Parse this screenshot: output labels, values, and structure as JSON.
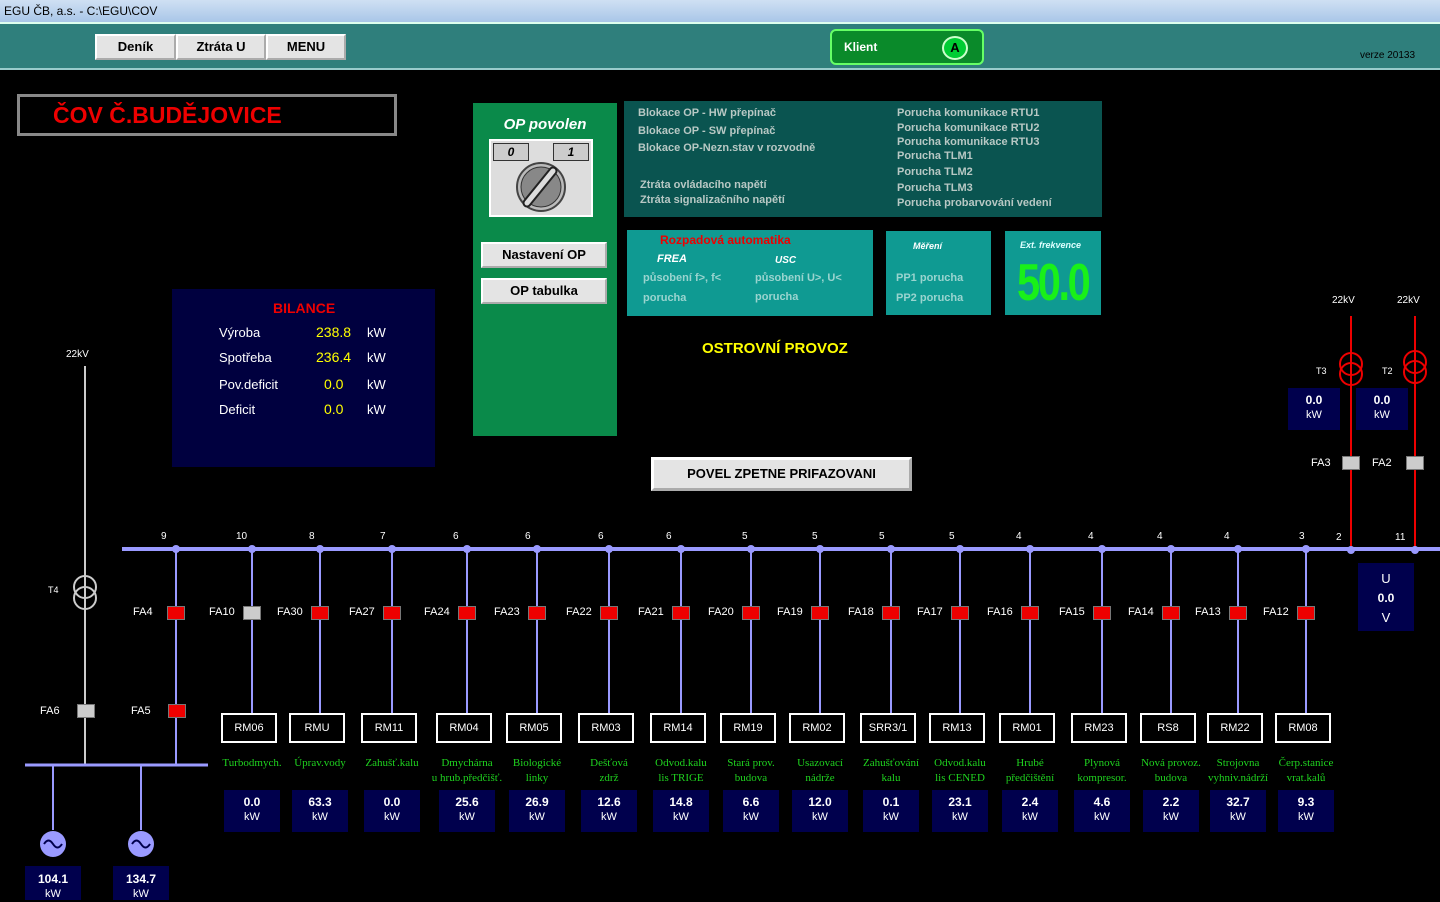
{
  "window": {
    "title": "EGU ČB, a.s. - C:\\EGU\\COV"
  },
  "toolbar": {
    "buttons": [
      "Deník",
      "Ztráta U",
      "MENU"
    ],
    "klient_label": "Klient",
    "klient_badge": "A",
    "verze": "verze  20133"
  },
  "header": {
    "title": "ČOV Č.BUDĚJOVICE"
  },
  "op": {
    "title": "OP povolen",
    "switch_left": "0",
    "switch_right": "1",
    "nastaveni_label": "Nastavení OP",
    "tabulka_label": "OP tabulka"
  },
  "alarms": {
    "left": [
      "Blokace OP - HW přepínač",
      "Blokace OP - SW přepínač",
      "Blokace OP-Nezn.stav v rozvodně",
      "Ztráta ovládacího napětí",
      "Ztráta signalizačního napětí"
    ],
    "right": [
      "Porucha komunikace RTU1",
      "Porucha komunikace RTU2",
      "Porucha komunikace RTU3",
      "Porucha TLM1",
      "Porucha TLM2",
      "Porucha TLM3",
      "Porucha probarvování vedení"
    ]
  },
  "rozpad": {
    "title": "Rozpadová automatika",
    "frea": "FREA",
    "usc": "USC",
    "frea_pusobeni": "působení f>, f<",
    "usc_pusobeni": "působení U>, U<",
    "frea_porucha": "porucha",
    "usc_porucha": "porucha"
  },
  "mereni": {
    "title": "Měření",
    "pp1": "PP1 porucha",
    "pp2": "PP2 porucha"
  },
  "ext_freq": {
    "label": "Ext. frekvence",
    "value": "50.0"
  },
  "ostrovni": "OSTROVNÍ PROVOZ",
  "bilance": {
    "title": "BILANCE",
    "rows": [
      {
        "label": "Výroba",
        "value": "238.8",
        "unit": "kW"
      },
      {
        "label": "Spotřeba",
        "value": "236.4",
        "unit": "kW"
      },
      {
        "label": "Pov.deficit",
        "value": "0.0",
        "unit": "kW"
      },
      {
        "label": "Deficit",
        "value": "0.0",
        "unit": "kW"
      }
    ]
  },
  "povel_label": "POVEL ZPETNE PRIFAZOVANI",
  "transformers": {
    "t4": {
      "voltage": "22kV",
      "name": "T4"
    },
    "t3": {
      "voltage": "22kV",
      "name": "T3",
      "value": "0.0",
      "unit": "kW",
      "breaker": "FA3"
    },
    "t2": {
      "voltage": "22kV",
      "name": "T2",
      "value": "0.0",
      "unit": "kW",
      "breaker": "FA2"
    }
  },
  "bus_numbers": {
    "pos2": "2",
    "pos11": "11"
  },
  "uv": {
    "top": "U",
    "value": "0.0",
    "bottom": "V"
  },
  "fa6": "FA6",
  "fa5": "FA5",
  "generators": [
    {
      "value": "104.1",
      "unit": "kW"
    },
    {
      "value": "134.7",
      "unit": "kW"
    }
  ],
  "feeders": [
    {
      "num": "9",
      "fa": "FA4",
      "state": "red",
      "rm": "",
      "desc1": "",
      "desc2": "",
      "value": "",
      "unit": ""
    },
    {
      "num": "10",
      "fa": "FA10",
      "state": "gray",
      "rm": "RM06",
      "desc1": "Turbodmych.",
      "desc2": "",
      "value": "0.0",
      "unit": "kW"
    },
    {
      "num": "8",
      "fa": "FA30",
      "state": "red",
      "rm": "RMU",
      "desc1": "Úprav.vody",
      "desc2": "",
      "value": "63.3",
      "unit": "kW"
    },
    {
      "num": "7",
      "fa": "FA27",
      "state": "red",
      "rm": "RM11",
      "desc1": "Zahušť.kalu",
      "desc2": "",
      "value": "0.0",
      "unit": "kW"
    },
    {
      "num": "6",
      "fa": "FA24",
      "state": "red",
      "rm": "RM04",
      "desc1": "Dmychárna",
      "desc2": "u hrub.předčišť.",
      "value": "25.6",
      "unit": "kW"
    },
    {
      "num": "6",
      "fa": "FA23",
      "state": "red",
      "rm": "RM05",
      "desc1": "Biologické",
      "desc2": "linky",
      "value": "26.9",
      "unit": "kW"
    },
    {
      "num": "6",
      "fa": "FA22",
      "state": "red",
      "rm": "RM03",
      "desc1": "Dešťová",
      "desc2": "zdrž",
      "value": "12.6",
      "unit": "kW"
    },
    {
      "num": "6",
      "fa": "FA21",
      "state": "red",
      "rm": "RM14",
      "desc1": "Odvod.kalu",
      "desc2": "lis TRIGE",
      "value": "14.8",
      "unit": "kW"
    },
    {
      "num": "5",
      "fa": "FA20",
      "state": "red",
      "rm": "RM19",
      "desc1": "Stará prov.",
      "desc2": "budova",
      "value": "6.6",
      "unit": "kW"
    },
    {
      "num": "5",
      "fa": "FA19",
      "state": "red",
      "rm": "RM02",
      "desc1": "Usazovací",
      "desc2": "nádrže",
      "value": "12.0",
      "unit": "kW"
    },
    {
      "num": "5",
      "fa": "FA18",
      "state": "red",
      "rm": "SRR3/1",
      "desc1": "Zahušťování",
      "desc2": "kalu",
      "value": "0.1",
      "unit": "kW"
    },
    {
      "num": "5",
      "fa": "FA17",
      "state": "red",
      "rm": "RM13",
      "desc1": "Odvod.kalu",
      "desc2": "lis CENED",
      "value": "23.1",
      "unit": "kW"
    },
    {
      "num": "4",
      "fa": "FA16",
      "state": "red",
      "rm": "RM01",
      "desc1": "Hrubé",
      "desc2": "předčištění",
      "value": "2.4",
      "unit": "kW"
    },
    {
      "num": "4",
      "fa": "FA15",
      "state": "red",
      "rm": "RM23",
      "desc1": "Plynová",
      "desc2": "kompresor.",
      "value": "4.6",
      "unit": "kW"
    },
    {
      "num": "4",
      "fa": "FA14",
      "state": "red",
      "rm": "RS8",
      "desc1": "Nová provoz.",
      "desc2": "budova",
      "value": "2.2",
      "unit": "kW"
    },
    {
      "num": "4",
      "fa": "FA13",
      "state": "red",
      "rm": "RM22",
      "desc1": "Strojovna",
      "desc2": "vyhniv.nádrží",
      "value": "32.7",
      "unit": "kW"
    },
    {
      "num": "3",
      "fa": "FA12",
      "state": "red",
      "rm": "RM08",
      "desc1": "Čerp.stanice",
      "desc2": "vrat.kalů",
      "value": "9.3",
      "unit": "kW"
    }
  ]
}
